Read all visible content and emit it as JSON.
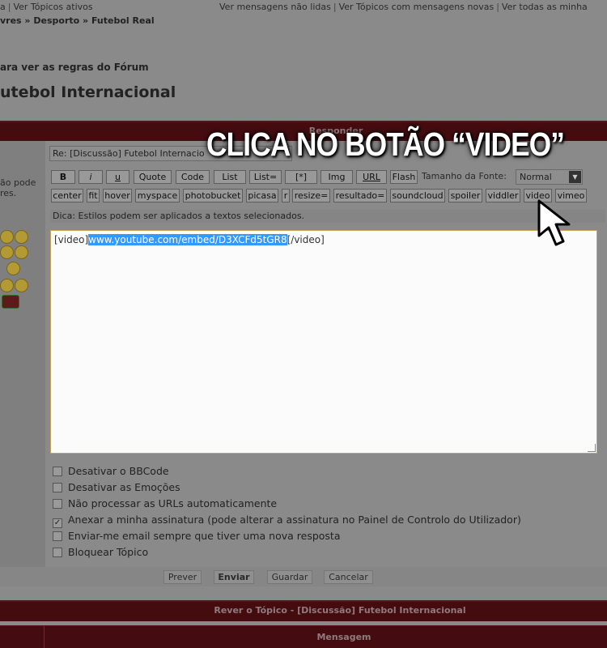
{
  "top_links": {
    "left_partial": "a",
    "left_item": "Ver Tópicos ativos",
    "right_items": [
      "Ver mensagens não lidas",
      "Ver Tópicos com mensagens novas",
      "Ver todas as minha"
    ]
  },
  "breadcrumb": "vres » Desporto » Futebol Real",
  "rules_link": "ara ver as regras do Fórum",
  "forum_title": "utebol Internacional",
  "reply_bar": "Responder",
  "left_note": [
    "ão pode",
    "res."
  ],
  "subject_value": "Re: [Discussão] Futebol Internacio",
  "toolbar_row1": [
    "B",
    "i",
    "u",
    "Quote",
    "Code",
    "List",
    "List=",
    "[*]",
    "Img",
    "URL",
    "Flash"
  ],
  "font_size": {
    "label": "Tamanho da Fonte:",
    "value": "Normal"
  },
  "toolbar_row2": [
    "center",
    "fit",
    "hover",
    "myspace",
    "photobucket",
    "picasa",
    "r",
    "resize=",
    "resultado=",
    "soundcloud",
    "spoiler",
    "viddler",
    "video",
    "vimeo"
  ],
  "hint": "Dica: Estilos podem ser aplicados a textos selecionados.",
  "message": {
    "prefix": "[video]",
    "selected": "www.youtube.com/embed/D3XCFd5tGR8",
    "suffix": "[/video]"
  },
  "options": [
    {
      "label": "Desativar o BBCode",
      "checked": false
    },
    {
      "label": "Desativar as Emoções",
      "checked": false
    },
    {
      "label": "Não processar as URLs automaticamente",
      "checked": false
    },
    {
      "label": "Anexar a minha assinatura (pode alterar a assinatura no Painel de Controlo do Utilizador)",
      "checked": true
    },
    {
      "label": "Enviar-me email sempre que tiver uma nova resposta",
      "checked": false
    },
    {
      "label": "Bloquear Tópico",
      "checked": false
    }
  ],
  "actions": [
    "Prever",
    "Enviar",
    "Guardar",
    "Cancelar"
  ],
  "review_bar": "Rever o Tópico - [Discussão] Futebol Internacional",
  "message_bar": "Mensagem",
  "overlay_instruction": "CLICA NO BOTÃO “VIDEO”",
  "icons": [
    "smiley-icon",
    "cursor-arrow-icon",
    "dropdown-arrow-icon",
    "resize-grip-icon"
  ],
  "colors": {
    "header_bar": "#450c10",
    "selection": "#3399ff",
    "textarea_border": "#c7a65a"
  }
}
